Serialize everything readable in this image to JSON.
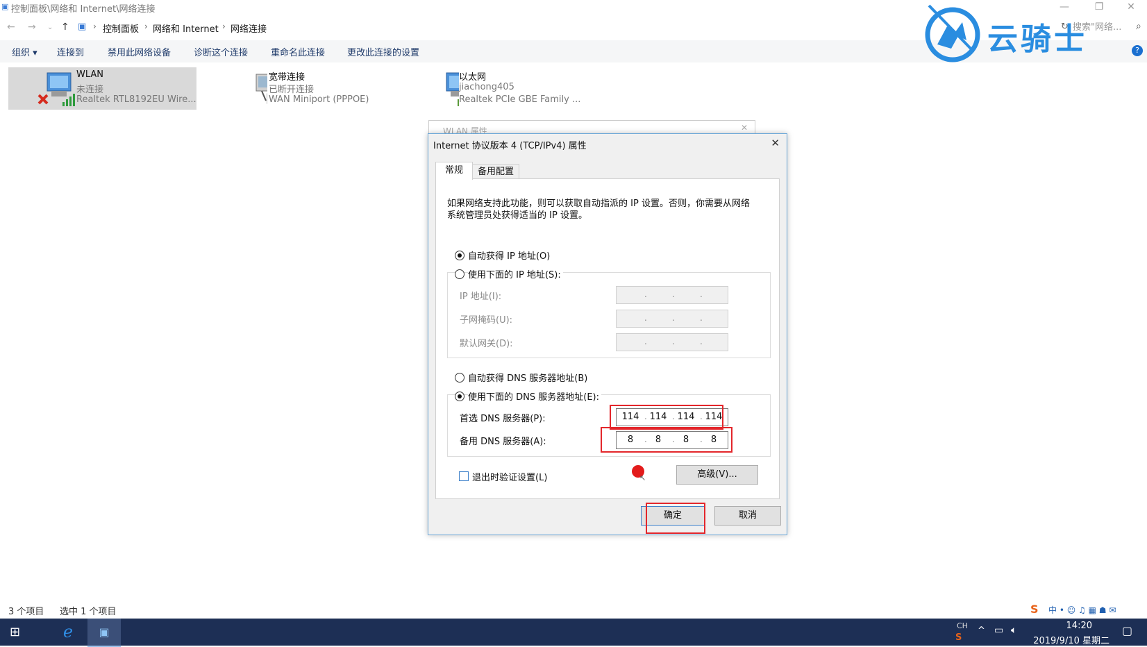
{
  "window": {
    "title": "控制面板\\网络和 Internet\\网络连接",
    "minimize": "—",
    "restore": "❐",
    "close": "✕"
  },
  "address": {
    "crumbs": [
      "控制面板",
      "网络和 Internet",
      "网络连接"
    ],
    "search_placeholder": "搜索\"网络..."
  },
  "toolbar": {
    "organize": "组织 ▾",
    "connect": "连接到",
    "disable": "禁用此网络设备",
    "diagnose": "诊断这个连接",
    "rename": "重命名此连接",
    "change": "更改此连接的设置"
  },
  "items": [
    {
      "name": "WLAN",
      "status": "未连接",
      "device": "Realtek RTL8192EU Wire...",
      "selected": true
    },
    {
      "name": "宽带连接",
      "status": "已断开连接",
      "device": "WAN Miniport (PPPOE)",
      "selected": false
    },
    {
      "name": "以太网",
      "status": "jiachong405",
      "device": "Realtek PCIe GBE Family ...",
      "selected": false
    }
  ],
  "bg_dialog": {
    "title": "WLAN 属性"
  },
  "dialog": {
    "title": "Internet 协议版本 4 (TCP/IPv4) 属性",
    "tabs": [
      "常规",
      "备用配置"
    ],
    "intro_line1": "如果网络支持此功能，则可以获取自动指派的 IP 设置。否则，你需要从网络",
    "intro_line2": "系统管理员处获得适当的 IP 设置。",
    "radio_auto_ip": "自动获得 IP 地址(O)",
    "radio_manual_ip": "使用下面的 IP 地址(S):",
    "ip_label": "IP 地址(I):",
    "mask_label": "子网掩码(U):",
    "gateway_label": "默认网关(D):",
    "radio_auto_dns": "自动获得 DNS 服务器地址(B)",
    "radio_manual_dns": "使用下面的 DNS 服务器地址(E):",
    "preferred_dns_label": "首选 DNS 服务器(P):",
    "alternate_dns_label": "备用 DNS 服务器(A):",
    "preferred_dns": [
      "114",
      "114",
      "114",
      "114"
    ],
    "alternate_dns": [
      "8",
      "8",
      "8",
      "8"
    ],
    "validate_label": "退出时验证设置(L)",
    "advanced": "高级(V)...",
    "ok": "确定",
    "cancel": "取消"
  },
  "statusbar": {
    "count": "3 个项目",
    "selected": "选中 1 个项目"
  },
  "taskbar": {
    "lang": "CH",
    "time": "14:20",
    "date": "2019/9/10 星期二"
  },
  "watermark": {
    "text": "云骑士"
  },
  "colors": {
    "highlight_red": "#e3262b",
    "dialog_border": "#6aa7d8",
    "taskbar": "#1d2f55",
    "watermark": "#2a8de0"
  }
}
